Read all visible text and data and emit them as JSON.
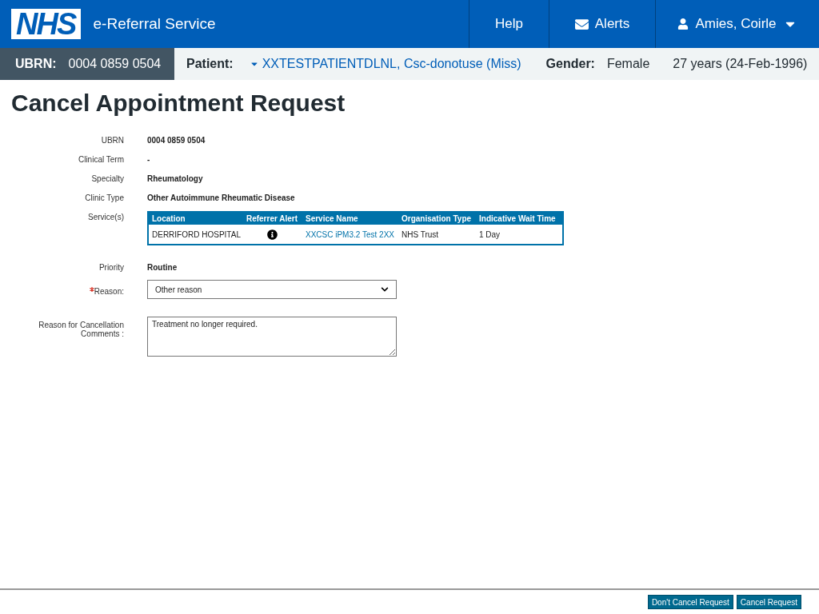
{
  "header": {
    "logo": "NHS",
    "service_name": "e-Referral Service",
    "nav": [
      {
        "kind": "link",
        "label": "Help"
      },
      {
        "kind": "mail",
        "label": "Alerts"
      },
      {
        "kind": "user",
        "label": "Amies, Coirle"
      }
    ]
  },
  "patient_bar": {
    "ubrn_label": "UBRN:",
    "ubrn": "0004 0859 0504",
    "patient_label": "Patient:",
    "patient_name": "XXTESTPATIENTDLNL, Csc-donotuse (Miss)",
    "gender_label": "Gender:",
    "gender": "Female",
    "age": "27 years (24-Feb-1996)"
  },
  "title": "Cancel Appointment Request",
  "details": [
    {
      "label": "UBRN",
      "value": "0004 0859 0504"
    },
    {
      "label": "Clinical Term",
      "value": "-"
    },
    {
      "label": "Specialty",
      "value": "Rheumatology"
    },
    {
      "label": "Clinic Type",
      "value": "Other Autoimmune Rheumatic Disease"
    }
  ],
  "services": {
    "label": "Service(s)",
    "columns": [
      "Location",
      "Referrer Alert",
      "Service Name",
      "Organisation Type",
      "Indicative Wait Time"
    ],
    "rows": [
      {
        "location": "DERRIFORD HOSPITAL",
        "service_name": "XXCSC iPM3.2 Test 2XX",
        "organisation_type": "NHS Trust",
        "wait_time": "1 Day"
      }
    ]
  },
  "priority": {
    "label": "Priority",
    "value": "Routine"
  },
  "reason": {
    "label": "Reason:",
    "required": true,
    "value": "Other reason"
  },
  "comments": {
    "label": "Reason for Cancellation Comments :",
    "value": "Treatment no longer required."
  },
  "buttons": [
    "Don't Cancel Request",
    "Cancel Request"
  ]
}
